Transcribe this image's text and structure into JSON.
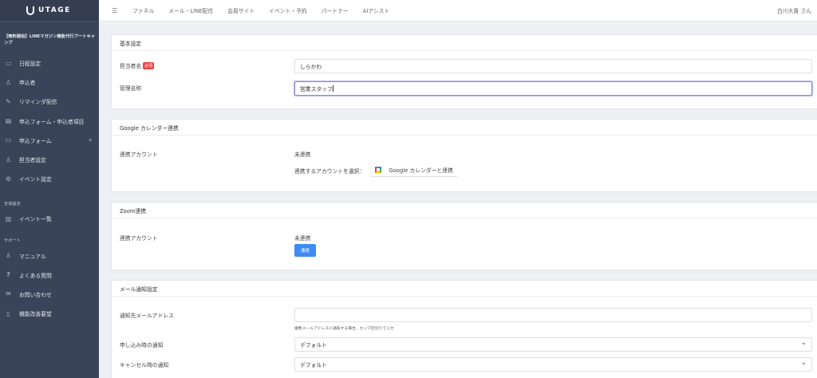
{
  "app": {
    "logo_text": "UTAGE"
  },
  "sidebar": {
    "project_title": "【無料開始】LINEマガジン機能代行ブートキャンプ",
    "items": [
      {
        "label": "日程設定",
        "icon": "calendar-icon"
      },
      {
        "label": "申込者",
        "icon": "person-icon"
      },
      {
        "label": "リマインダ配信",
        "icon": "pencil-icon"
      },
      {
        "label": "申込フォーム・申込者項目",
        "icon": "table-icon"
      },
      {
        "label": "申込フォーム",
        "icon": "form-icon",
        "expand": "+"
      },
      {
        "label": "担当者設定",
        "icon": "users-icon"
      },
      {
        "label": "イベント設定",
        "icon": "gear-icon"
      }
    ],
    "section_overall": "全体設定",
    "overall_items": [
      {
        "label": "イベント一覧",
        "icon": "chart-icon"
      }
    ],
    "section_support": "サポート",
    "support_items": [
      {
        "label": "マニュアル",
        "icon": "person-icon"
      },
      {
        "label": "よくある質問",
        "icon": "question-icon"
      },
      {
        "label": "お問い合わせ",
        "icon": "chat-icon"
      },
      {
        "label": "機能改善要望",
        "icon": "document-icon"
      }
    ]
  },
  "topbar": {
    "nav": [
      "ファネル",
      "メール・LINE配信",
      "会員サイト",
      "イベント・予約",
      "パートナー",
      "AIアシスト"
    ],
    "user": "白川大貴 さん"
  },
  "basic": {
    "title": "基本設定",
    "staff_name_label": "担当者名",
    "required_badge": "必須",
    "staff_name_value": "しらかわ",
    "admin_name_label": "管理名称",
    "admin_name_value": "営業スタッフ"
  },
  "google": {
    "title": "Google カレンダー連携",
    "account_label": "連携アカウント",
    "status": "未連携",
    "select_label": "連携するアカウントを選択：",
    "connect_button": "Google カレンダーと連携"
  },
  "zoom": {
    "title": "Zoom連携",
    "account_label": "連携アカウント",
    "status": "未連携",
    "connect_button": "連携"
  },
  "mail": {
    "title": "メール通知設定",
    "address_label": "通知先メールアドレス",
    "address_value": "",
    "address_hint": "複数メールアドレスに通知する場合、カンマ区切りで入力",
    "apply_label": "申し込み時の通知",
    "apply_value": "デフォルト",
    "cancel_label": "キャンセル時の通知",
    "cancel_value": "デフォルト"
  }
}
